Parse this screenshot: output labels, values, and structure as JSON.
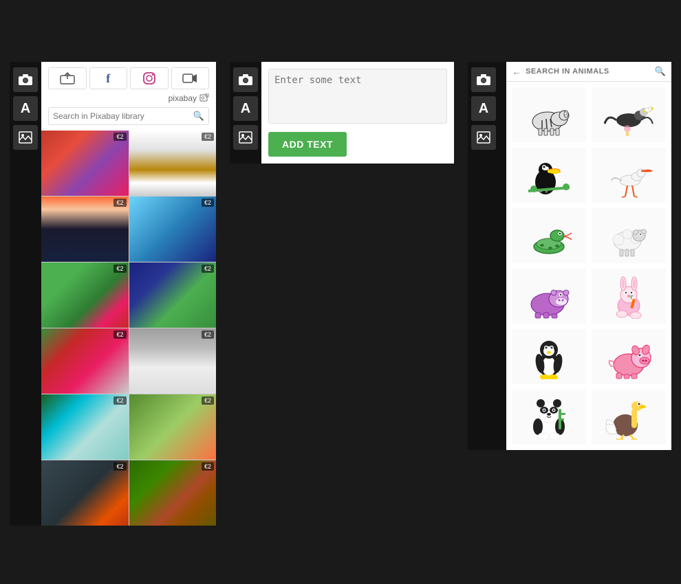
{
  "panel1": {
    "upload_icon": "⬆",
    "facebook_icon": "f",
    "instagram_icon": "📷",
    "camera_icon": "📷",
    "pixabay_label": "pixabay",
    "pixabay_icon": "📷",
    "search_placeholder": "Search in Pixabay library",
    "images": [
      {
        "id": 1,
        "badge": "€2",
        "class": "img-1"
      },
      {
        "id": 2,
        "badge": "€2",
        "class": "img-2"
      },
      {
        "id": 3,
        "badge": "€2",
        "class": "img-3"
      },
      {
        "id": 4,
        "badge": "€2",
        "class": "img-4"
      },
      {
        "id": 5,
        "badge": "€2",
        "class": "img-5"
      },
      {
        "id": 6,
        "badge": "€2",
        "class": "img-6"
      },
      {
        "id": 7,
        "badge": "€2",
        "class": "img-7"
      },
      {
        "id": 8,
        "badge": "€2",
        "class": "img-8"
      },
      {
        "id": 9,
        "badge": "€2",
        "class": "img-9"
      },
      {
        "id": 10,
        "badge": "€2",
        "class": "img-10"
      },
      {
        "id": 11,
        "badge": "€2",
        "class": "img-11"
      },
      {
        "id": 12,
        "badge": "€2",
        "class": "img-1"
      }
    ]
  },
  "panel2": {
    "text_input_placeholder": "Enter some text",
    "add_text_label": "ADD TEXT"
  },
  "panel3": {
    "back_icon": "←",
    "search_placeholder": "SEARCH IN ANIMALS",
    "search_icon": "🔍",
    "animals": [
      {
        "id": 1,
        "name": "zebra",
        "color": "#e0e0e0"
      },
      {
        "id": 2,
        "name": "vulture",
        "color": "#c0c0c0"
      },
      {
        "id": 3,
        "name": "toucan",
        "color": "#4caf50"
      },
      {
        "id": 4,
        "name": "stork",
        "color": "#f5f5f5"
      },
      {
        "id": 5,
        "name": "snake",
        "color": "#4caf50"
      },
      {
        "id": 6,
        "name": "sheep",
        "color": "#fafafa"
      },
      {
        "id": 7,
        "name": "hippo",
        "color": "#ba68c8"
      },
      {
        "id": 8,
        "name": "rabbit",
        "color": "#f8bbd9"
      },
      {
        "id": 9,
        "name": "penguin",
        "color": "#212121"
      },
      {
        "id": 10,
        "name": "pig",
        "color": "#f48fb1"
      },
      {
        "id": 11,
        "name": "panda",
        "color": "#212121"
      },
      {
        "id": 12,
        "name": "ostrich",
        "color": "#ffd54f"
      }
    ]
  },
  "sidebar": {
    "camera_icon": "📷",
    "text_icon": "A",
    "image_icon": "🖼"
  }
}
